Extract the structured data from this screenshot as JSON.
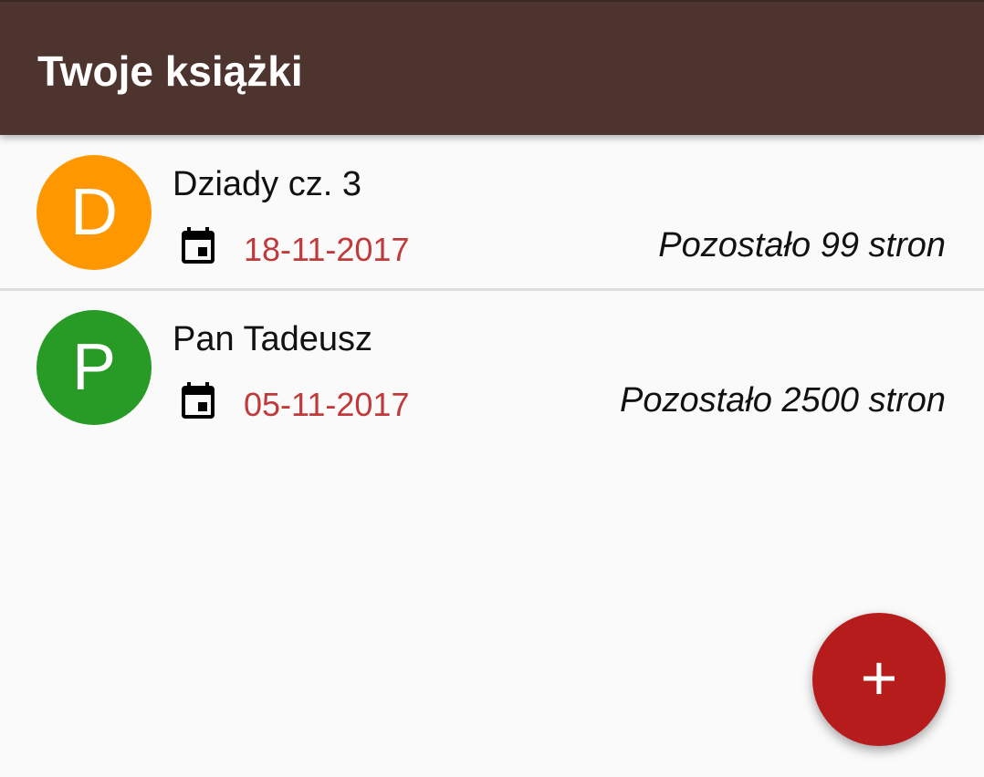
{
  "appbar": {
    "title": "Twoje książki",
    "color": "#4e342e"
  },
  "books": [
    {
      "initial": "D",
      "avatar_color": "#ff9800",
      "title": "Dziady cz. 3",
      "date_icon": "calendar-icon",
      "date": "18-11-2017",
      "remaining": "Pozostało 99 stron"
    },
    {
      "initial": "P",
      "avatar_color": "#279b26",
      "title": "Pan Tadeusz",
      "date_icon": "calendar-icon",
      "date": "05-11-2017",
      "remaining": "Pozostało 2500 stron"
    }
  ],
  "fab": {
    "icon": "plus-icon",
    "label": "+",
    "color": "#b71c1c"
  },
  "date_color": "#c0393b"
}
